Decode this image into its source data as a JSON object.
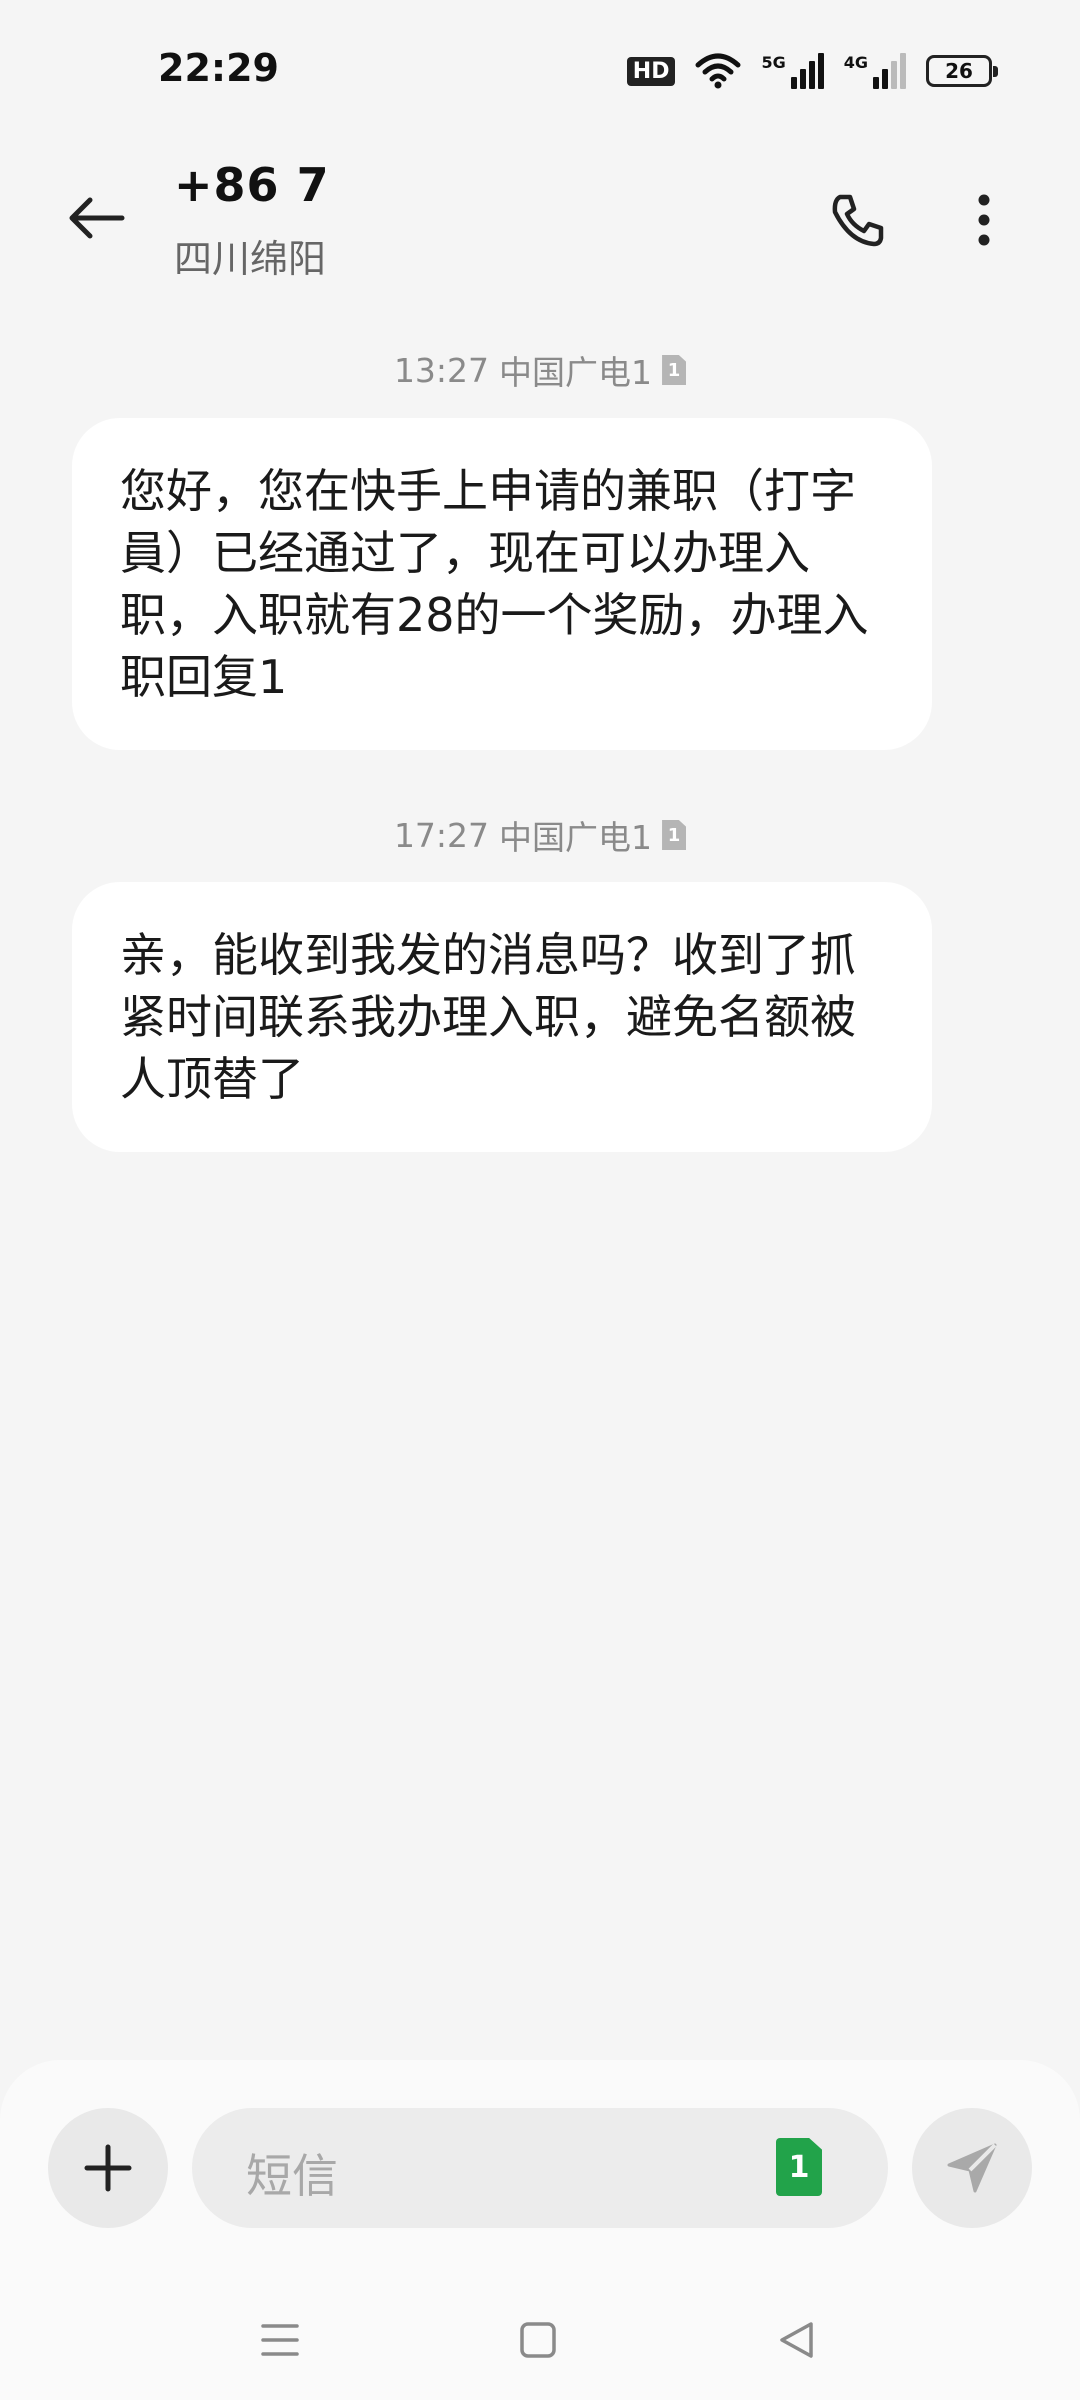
{
  "status_bar": {
    "time": "22:29",
    "hd_label": "HD",
    "network_1": "5G",
    "network_2": "4G",
    "battery": "26",
    "icons": [
      "hd-icon",
      "wifi-icon",
      "signal-5g-icon",
      "signal-4g-icon",
      "battery-icon"
    ]
  },
  "header": {
    "contact_name": "+86 7",
    "contact_location": "四川绵阳",
    "icons": [
      "back-arrow-icon",
      "phone-icon",
      "more-vert-icon"
    ]
  },
  "messages": [
    {
      "time": "13:27",
      "carrier": "中国广电1",
      "sim": "1",
      "text": "您好，您在快手上申请的兼职（打字員）已经通过了，现在可以办理入职，入职就有28的一个奖励，办理入职回复1"
    },
    {
      "time": "17:27",
      "carrier": "中国广电1",
      "sim": "1",
      "text": "亲，能收到我发的消息吗？收到了抓紧时间联系我办理入职，避免名额被人顶替了"
    }
  ],
  "composer": {
    "placeholder": "短信",
    "sim_slot": "1",
    "icons": [
      "plus-icon",
      "sim-card-icon",
      "send-icon"
    ]
  },
  "nav_bar": {
    "icons": [
      "menu-icon",
      "home-icon",
      "back-triangle-icon"
    ]
  }
}
